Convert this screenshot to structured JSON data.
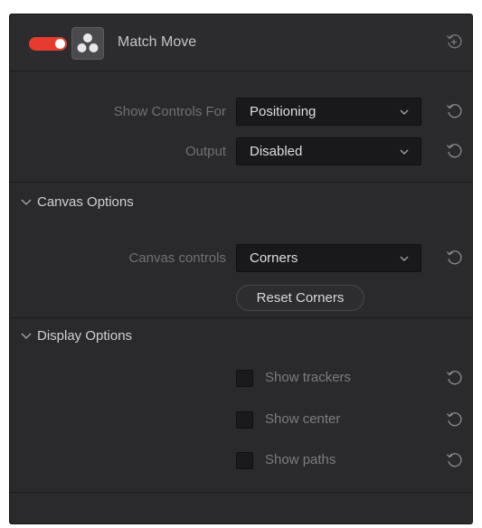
{
  "header": {
    "title": "Match Move",
    "toggle": {
      "state": "on",
      "color": "#e63b2e"
    },
    "effect_icon": "davinci-resolve-logo-icon",
    "reset_icon": "add-keyframe-icon"
  },
  "controls": {
    "show_controls_for": {
      "label": "Show Controls For",
      "value": "Positioning"
    },
    "output": {
      "label": "Output",
      "value": "Disabled"
    }
  },
  "canvas_options": {
    "heading": "Canvas Options",
    "expanded": true,
    "canvas_controls": {
      "label": "Canvas controls",
      "value": "Corners"
    },
    "reset_button_label": "Reset Corners"
  },
  "display_options": {
    "heading": "Display Options",
    "expanded": true,
    "checkboxes": [
      {
        "label": "Show trackers",
        "checked": false
      },
      {
        "label": "Show center",
        "checked": false
      },
      {
        "label": "Show paths",
        "checked": false
      }
    ]
  },
  "icons": {
    "reset": "reset-icon",
    "dropdown": "chevron-down-icon",
    "section_toggle": "chevron-down-icon"
  }
}
